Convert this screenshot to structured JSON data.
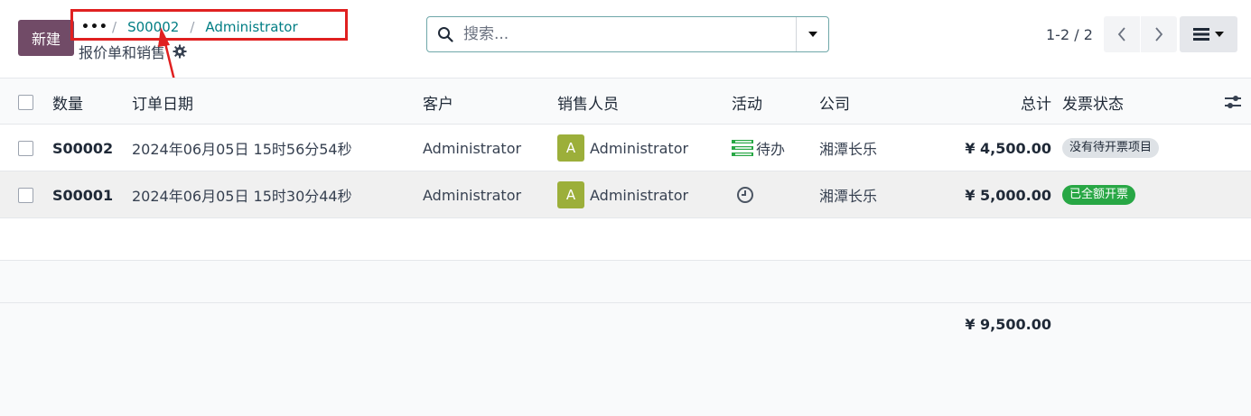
{
  "control_panel": {
    "new_button": "新建",
    "breadcrumb": {
      "more": "•••",
      "separator": "/",
      "items": [
        "S00002",
        "Administrator"
      ]
    },
    "subtitle": "报价单和销售",
    "search": {
      "placeholder": "搜索..."
    },
    "pager": {
      "value": "1-2 / 2"
    },
    "view_icon": "list-view-icon"
  },
  "table": {
    "headers": {
      "qty": "数量",
      "date": "订单日期",
      "customer": "客户",
      "salesperson": "销售人员",
      "activity": "活动",
      "company": "公司",
      "total": "总计",
      "invoice_status": "发票状态"
    },
    "rows": [
      {
        "ref": "S00002",
        "date": "2024年06月05日 15时56分54秒",
        "customer": "Administrator",
        "avatar": "A",
        "salesperson": "Administrator",
        "activity": "待办",
        "activity_icon": "todo-list-icon",
        "company": "湘潭长乐",
        "total": "¥ 4,500.00",
        "invoice_status": "没有待开票项目"
      },
      {
        "ref": "S00001",
        "date": "2024年06月05日 15时30分44秒",
        "customer": "Administrator",
        "avatar": "A",
        "salesperson": "Administrator",
        "activity_icon": "clock-icon",
        "company": "湘潭长乐",
        "total": "¥ 5,000.00",
        "invoice_status": "已全额开票"
      }
    ],
    "grand_total": "¥ 9,500.00"
  },
  "colors": {
    "brand": "#714b67",
    "link": "#017e84",
    "avatar": "#9caf3a",
    "badge_green": "#28a745",
    "annotation_red": "#e02020"
  }
}
